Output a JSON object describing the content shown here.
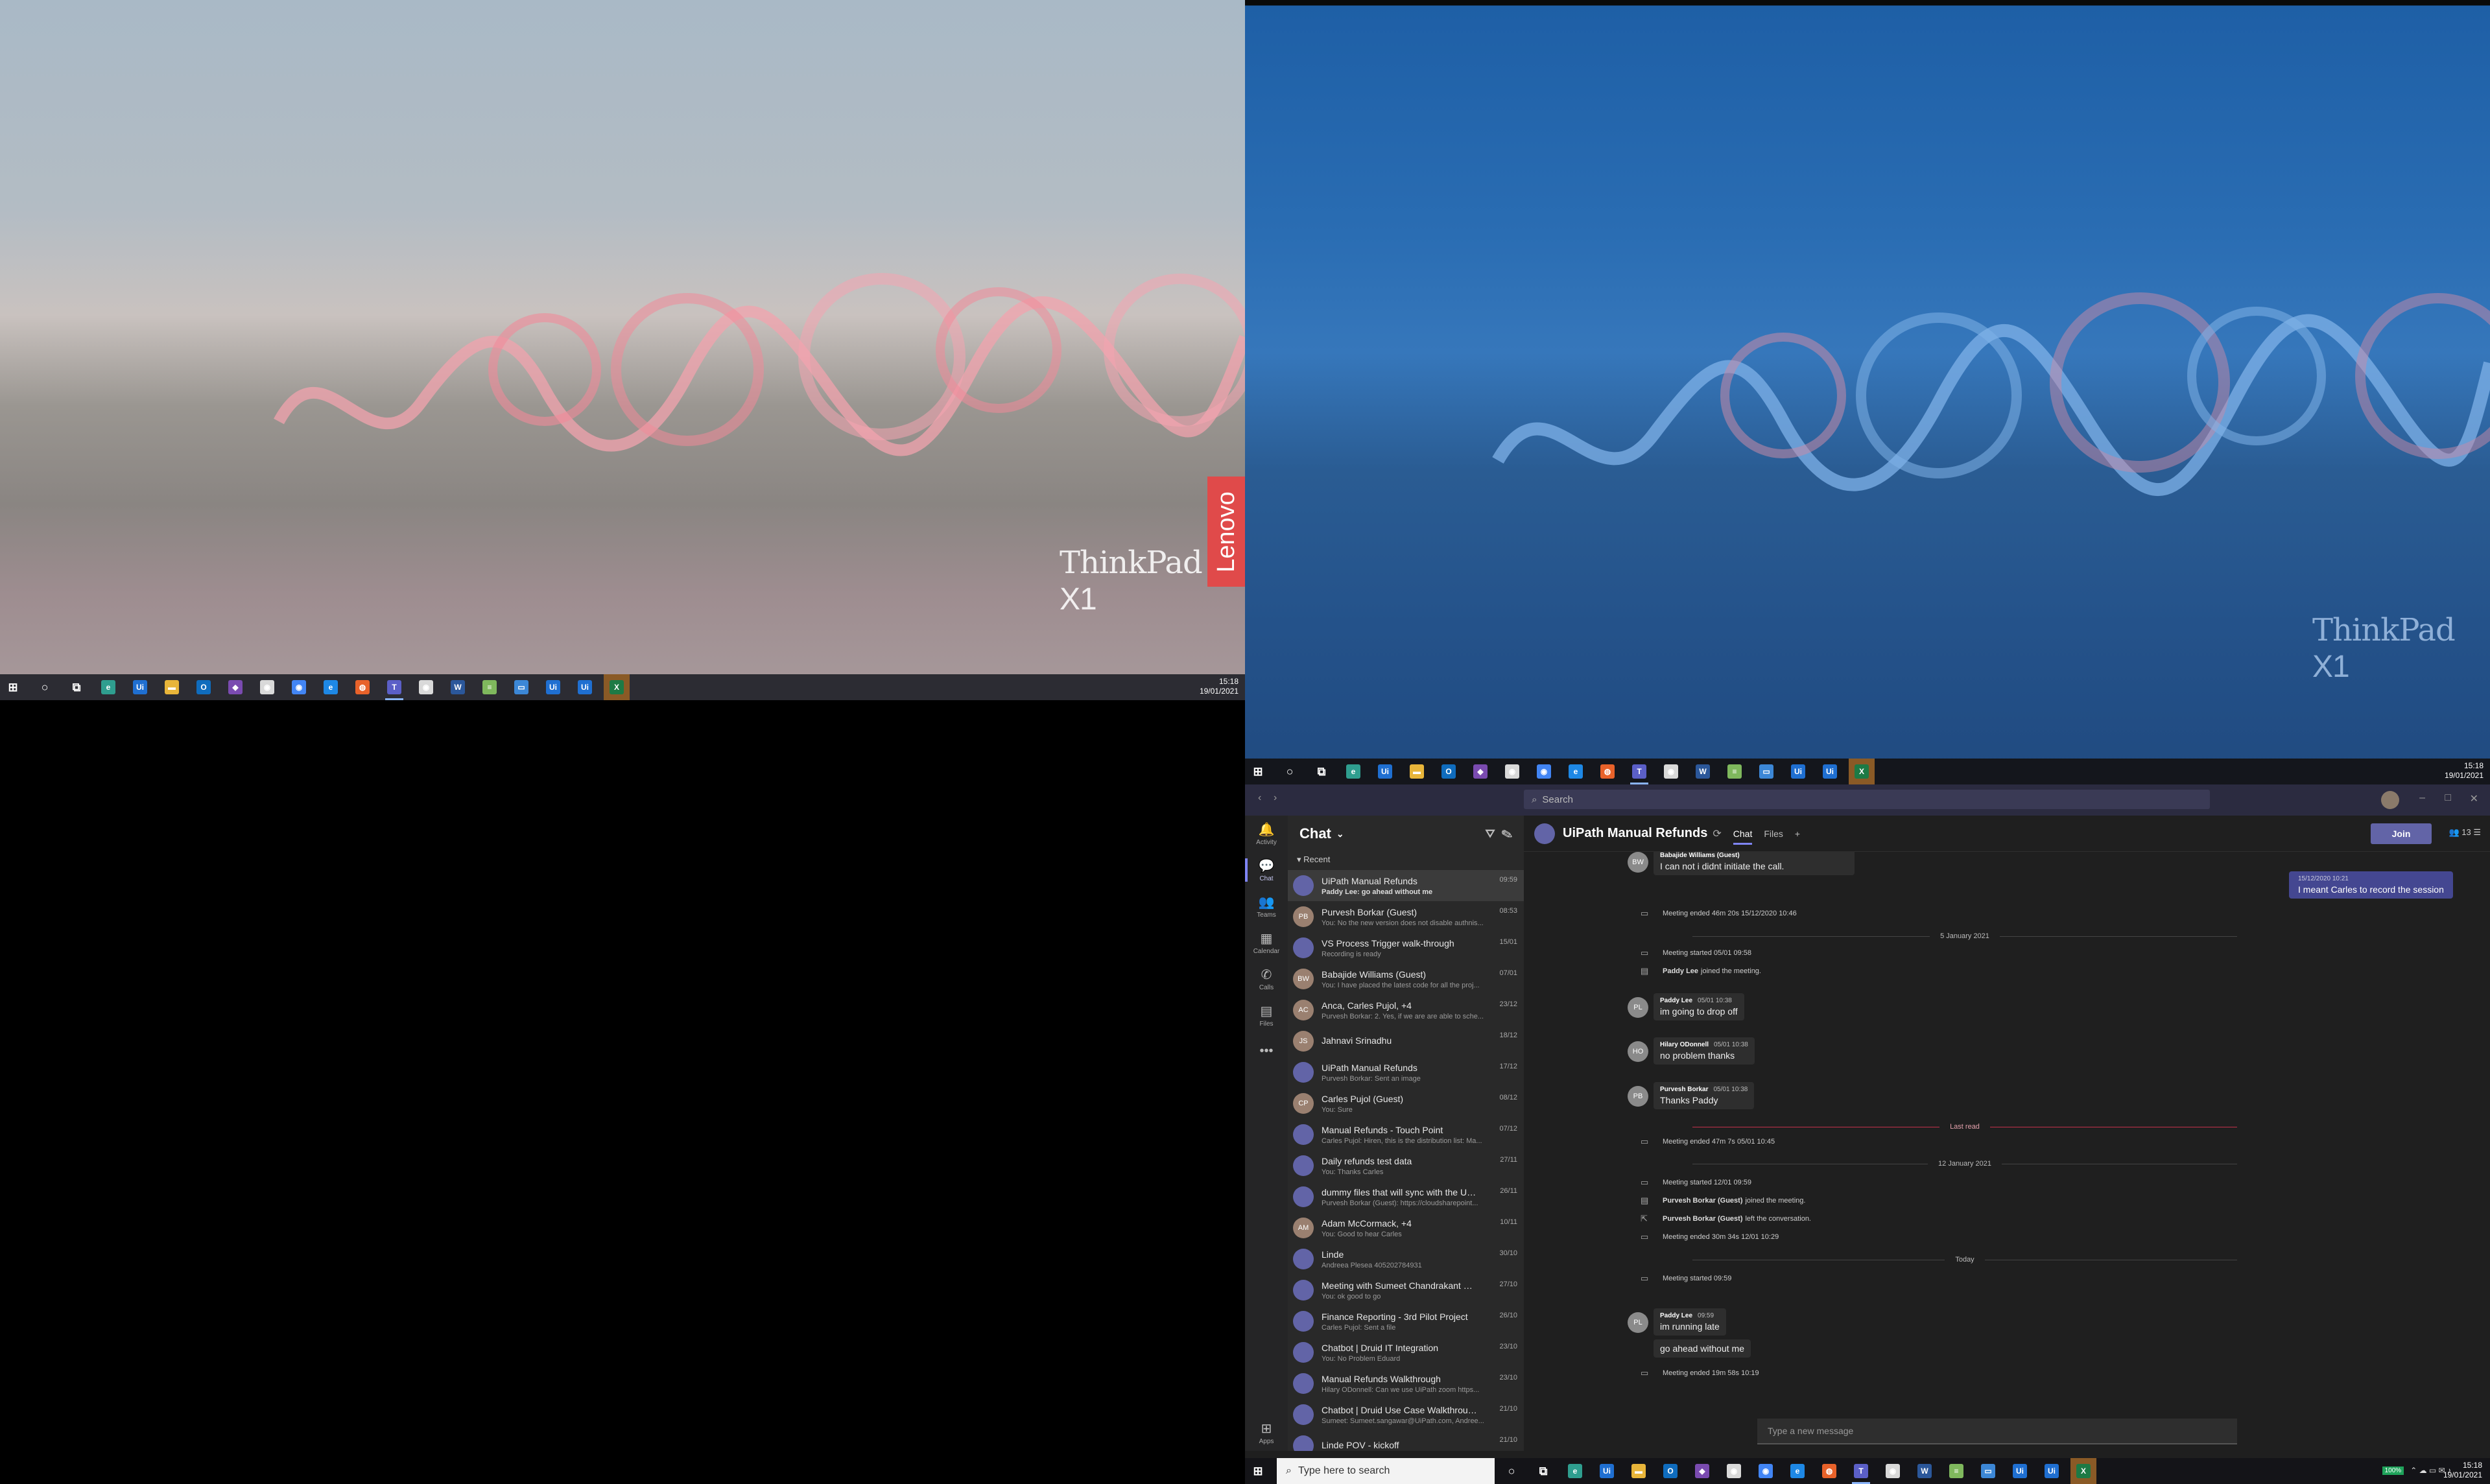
{
  "monitor1": {
    "brand_thinkpad": "ThinkPad",
    "brand_x1": "X1",
    "brand_lenovo": "Lenovo",
    "clock_time": "15:18",
    "clock_date": "19/01/2021"
  },
  "monitor2": {
    "brand_thinkpad": "ThinkPad",
    "brand_x1": "X1",
    "clock_time": "15:18",
    "clock_date": "19/01/2021"
  },
  "taskbar_icons": [
    {
      "name": "windows-start-icon",
      "glyph": "⊞",
      "color": "#ffffff"
    },
    {
      "name": "cortana-icon",
      "glyph": "○",
      "color": "#ffffff"
    },
    {
      "name": "task-view-icon",
      "glyph": "⧉",
      "color": "#ffffff"
    },
    {
      "name": "edge-icon",
      "glyph": "e",
      "color": "#2f9e8f"
    },
    {
      "name": "uipath-icon",
      "glyph": "Ui",
      "color": "#1f6fd1"
    },
    {
      "name": "file-explorer-icon",
      "glyph": "▬",
      "color": "#e8b53a"
    },
    {
      "name": "outlook-icon",
      "glyph": "O",
      "color": "#0f6cbd"
    },
    {
      "name": "visual-studio-icon",
      "glyph": "◆",
      "color": "#7a4bb0"
    },
    {
      "name": "chrome-icon",
      "glyph": "◉",
      "color": "#d9d9d9"
    },
    {
      "name": "chrome-icon",
      "glyph": "◉",
      "color": "#4285f4"
    },
    {
      "name": "internet-explorer-icon",
      "glyph": "e",
      "color": "#1e88e5"
    },
    {
      "name": "firefox-icon",
      "glyph": "◍",
      "color": "#e8622a"
    },
    {
      "name": "teams-icon",
      "glyph": "T",
      "color": "#5b5fc7"
    },
    {
      "name": "chrome-icon",
      "glyph": "◉",
      "color": "#d9d9d9"
    },
    {
      "name": "word-icon",
      "glyph": "W",
      "color": "#2b579a"
    },
    {
      "name": "notepad-icon",
      "glyph": "≡",
      "color": "#7fb85d"
    },
    {
      "name": "remote-desktop-icon",
      "glyph": "▭",
      "color": "#3c87d6"
    },
    {
      "name": "uipath-icon",
      "glyph": "Ui",
      "color": "#1f6fd1"
    },
    {
      "name": "uipath-icon",
      "glyph": "Ui",
      "color": "#1f6fd1"
    },
    {
      "name": "excel-icon",
      "glyph": "X",
      "color": "#1d7a45"
    }
  ],
  "teams": {
    "search_placeholder": "Search",
    "rail": [
      {
        "label": "Activity",
        "glyph": "🔔"
      },
      {
        "label": "Chat",
        "glyph": "💬"
      },
      {
        "label": "Teams",
        "glyph": "👥"
      },
      {
        "label": "Calendar",
        "glyph": "▦"
      },
      {
        "label": "Calls",
        "glyph": "✆"
      },
      {
        "label": "Files",
        "glyph": "▤"
      },
      {
        "label": "",
        "glyph": "•••"
      }
    ],
    "rail_apps_label": "Apps",
    "chat_header": "Chat",
    "recent_label": "Recent",
    "chats": [
      {
        "name": "UiPath Manual Refunds",
        "preview": "Paddy Lee: go ahead without me",
        "time": "09:59",
        "initials": ""
      },
      {
        "name": "Purvesh Borkar (Guest)",
        "preview": "You: No the new version does not disable authnis...",
        "time": "08:53",
        "initials": "PB"
      },
      {
        "name": "VS Process Trigger walk-through",
        "preview": "Recording is ready",
        "time": "15/01",
        "initials": ""
      },
      {
        "name": "Babajide Williams (Guest)",
        "preview": "You: I have placed the latest code for all the proj...",
        "time": "07/01",
        "initials": "BW"
      },
      {
        "name": "Anca, Carles Pujol, +4",
        "preview": "Purvesh Borkar: 2. Yes, if we are are able to sche...",
        "time": "23/12",
        "initials": "AC"
      },
      {
        "name": "Jahnavi Srinadhu",
        "preview": "",
        "time": "18/12",
        "initials": "JS"
      },
      {
        "name": "UiPath Manual Refunds",
        "preview": "Purvesh Borkar: Sent an image",
        "time": "17/12",
        "initials": ""
      },
      {
        "name": "Carles Pujol (Guest)",
        "preview": "You: Sure",
        "time": "08/12",
        "initials": "CP"
      },
      {
        "name": "Manual Refunds - Touch Point",
        "preview": "Carles Pujol: Hiren, this is the distribution list: Ma...",
        "time": "07/12",
        "initials": ""
      },
      {
        "name": "Daily refunds test data",
        "preview": "You: Thanks Carles",
        "time": "27/11",
        "initials": ""
      },
      {
        "name": "dummy files that will sync with the UA...",
        "preview": "Purvesh Borkar (Guest): https://cloudsharepoint...",
        "time": "26/11",
        "initials": ""
      },
      {
        "name": "Adam McCormack, +4",
        "preview": "You: Good to hear Carles",
        "time": "10/11",
        "initials": "AM"
      },
      {
        "name": "Linde",
        "preview": "Andreea Pleseа 405202784931",
        "time": "30/10",
        "initials": ""
      },
      {
        "name": "Meeting with Sumeet Chandrakant Sa...",
        "preview": "You: ok good to go",
        "time": "27/10",
        "initials": ""
      },
      {
        "name": "Finance Reporting - 3rd Pilot Project",
        "preview": "Carles Pujol: Sent a file",
        "time": "26/10",
        "initials": ""
      },
      {
        "name": "Chatbot | Druid IT Integration",
        "preview": "You: No Problem Eduard",
        "time": "23/10",
        "initials": ""
      },
      {
        "name": "Manual Refunds Walkthrough",
        "preview": "Hilary ODonnell: Can we use UiPath zoom https...",
        "time": "23/10",
        "initials": ""
      },
      {
        "name": "Chatbot | Druid Use Case Walkthrough",
        "preview": "Sumeet: Sumeet.sangawar@UiPath.com, Andree...",
        "time": "21/10",
        "initials": ""
      },
      {
        "name": "Linde POV - kickoff",
        "preview": "",
        "time": "21/10",
        "initials": ""
      }
    ],
    "conversation": {
      "title": "UiPath Manual Refunds",
      "tab_chat": "Chat",
      "tab_files": "Files",
      "join": "Join",
      "participants": "13",
      "top_msg_meta": "Babajide Williams (Guest)",
      "top_msg_body": "I can not i didnt initiate the call.",
      "mine_meta": "15/12/2020 10:21",
      "mine_body": "I meant Carles to record the session",
      "ev_ended_1": "Meeting ended  46m 20s   15/12/2020 10:46",
      "div_5jan": "5 January 2021",
      "ev_started_1": "Meeting started   05/01 09:58",
      "ev_joined_1_name": "Paddy Lee",
      "ev_joined_1": "joined the meeting.",
      "msg1_author": "Paddy Lee",
      "msg1_time": "05/01 10:38",
      "msg1_body": "im going to drop off",
      "msg2_author": "Hilary ODonnell",
      "msg2_time": "05/01 10:38",
      "msg2_body": "no problem thanks",
      "msg3_author": "Purvesh Borkar",
      "msg3_time": "05/01 10:38",
      "msg3_body": "Thanks Paddy",
      "div_lastread": "Last read",
      "ev_ended_2": "Meeting ended  47m 7s   05/01 10:45",
      "div_12jan": "12 January 2021",
      "ev_started_2": "Meeting started   12/01 09:59",
      "ev_joined_2_name": "Purvesh Borkar (Guest)",
      "ev_joined_2": "joined the meeting.",
      "ev_left_name": "Purvesh Borkar (Guest)",
      "ev_left": "left the conversation.",
      "ev_ended_3": "Meeting ended  30m 34s   12/01 10:29",
      "div_today": "Today",
      "ev_started_3": "Meeting started   09:59",
      "msg4_author": "Paddy Lee",
      "msg4_time": "09:59",
      "msg4_body": "im running late",
      "msg5_body": "go ahead without me",
      "ev_ended_4": "Meeting ended  19m 58s   10:19",
      "compose_placeholder": "Type a new message"
    }
  },
  "monitor3_taskbar": {
    "search_placeholder": "Type here to search",
    "battery": "100%",
    "clock_time": "15:18",
    "clock_date": "19/01/2021"
  }
}
